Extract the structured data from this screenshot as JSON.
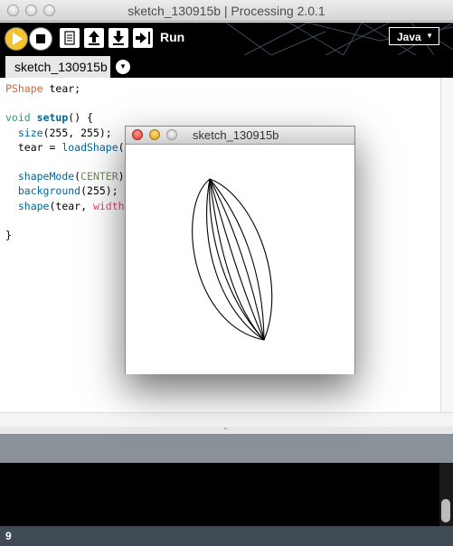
{
  "window": {
    "title": "sketch_130915b | Processing 2.0.1"
  },
  "toolbar": {
    "run_label": "Run",
    "mode_label": "Java",
    "buttons": [
      "play-icon",
      "stop-icon",
      "new-sketch-icon",
      "open-icon",
      "save-icon",
      "export-icon"
    ]
  },
  "tabs": {
    "active_tab": "sketch_130915b"
  },
  "editor": {
    "lines": [
      [
        "PShape",
        " tear;"
      ],
      [
        ""
      ],
      [
        "void",
        " ",
        "setup",
        "() {"
      ],
      [
        "  ",
        "size",
        "(255, 255);"
      ],
      [
        "  tear = ",
        "loadShape",
        "("
      ],
      [
        ""
      ],
      [
        "  ",
        "shapeMode",
        "(",
        "CENTER",
        ")"
      ],
      [
        "  ",
        "background",
        "(255);"
      ],
      [
        "  ",
        "shape",
        "(tear, ",
        "width"
      ],
      [
        ""
      ],
      [
        "}"
      ]
    ]
  },
  "status": {
    "line_number": "9"
  },
  "sketch_window": {
    "title": "sketch_130915b"
  },
  "colors": {
    "play_button": "#f3c330",
    "toolbar_bg": "#000000",
    "keyword": "#cc6633",
    "function": "#006699",
    "constant": "#718a62",
    "builtin_var": "#d94a7a",
    "statusbar_bg": "#404a54"
  }
}
